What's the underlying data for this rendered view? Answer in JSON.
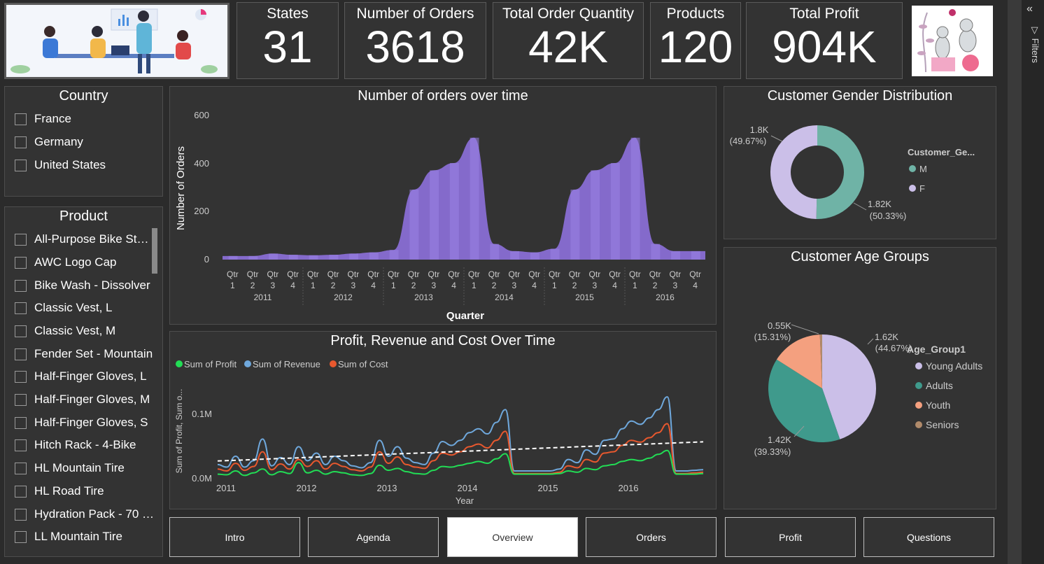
{
  "kpis": {
    "states": {
      "label": "States",
      "value": "31"
    },
    "orders": {
      "label": "Number of Orders",
      "value": "3618"
    },
    "quantity": {
      "label": "Total Order Quantity",
      "value": "42K"
    },
    "products": {
      "label": "Products",
      "value": "120"
    },
    "profit": {
      "label": "Total Profit",
      "value": "904K"
    }
  },
  "country_slicer": {
    "title": "Country",
    "items": [
      "France",
      "Germany",
      "United States"
    ]
  },
  "product_slicer": {
    "title": "Product",
    "items": [
      "All-Purpose Bike St…",
      "AWC Logo Cap",
      "Bike Wash - Dissolver",
      "Classic Vest, L",
      "Classic Vest, M",
      "Fender Set - Mountain",
      "Half-Finger Gloves, L",
      "Half-Finger Gloves, M",
      "Half-Finger Gloves, S",
      "Hitch Rack - 4-Bike",
      "HL Mountain Tire",
      "HL Road Tire",
      "Hydration Pack - 70 …",
      "LL Mountain Tire"
    ]
  },
  "orders_chart": {
    "title": "Number of orders over time",
    "ylabel": "Number of Orders",
    "xlabel": "Quarter",
    "yticks": [
      "600",
      "400",
      "200",
      "0"
    ],
    "quarters": [
      "Qtr 1",
      "Qtr 2",
      "Qtr 3",
      "Qtr 4"
    ],
    "years": [
      "2011",
      "2012",
      "2013",
      "2014",
      "2015",
      "2016"
    ]
  },
  "profit_chart": {
    "title": "Profit, Revenue and Cost Over Time",
    "legend": [
      "Sum of Profit",
      "Sum of Revenue",
      "Sum of Cost"
    ],
    "ylabel": "Sum of Profit, Sum o...",
    "xlabel": "Year",
    "yticks": [
      "0.1M",
      "0.0M"
    ],
    "xticks": [
      "2011",
      "2012",
      "2013",
      "2014",
      "2015",
      "2016"
    ]
  },
  "gender_chart": {
    "title": "Customer Gender Distribution",
    "legend_title": "Customer_Ge...",
    "labels": {
      "f_value": "1.8K",
      "f_pct": "(49.67%)",
      "m_value": "1.82K",
      "m_pct": "(50.33%)"
    },
    "legend": [
      "M",
      "F"
    ]
  },
  "age_chart": {
    "title": "Customer Age Groups",
    "legend_title": "Age_Group1",
    "legend": [
      "Young Adults",
      "Adults",
      "Youth",
      "Seniors"
    ],
    "labels": {
      "ya_value": "1.62K",
      "ya_pct": "(44.67%)",
      "ad_value": "1.42K",
      "ad_pct": "(39.33%)",
      "yo_value": "0.55K",
      "yo_pct": "(15.31%)"
    }
  },
  "nav": [
    "Intro",
    "Agenda",
    "Overview",
    "Orders",
    "Profit",
    "Questions"
  ],
  "filters_label": "Filters",
  "colors": {
    "purple": "#8b6fd8",
    "teal": "#6fb3a6",
    "lavender": "#cbbfe8",
    "profit": "#22dd55",
    "revenue": "#6fa8dc",
    "cost": "#e8582e",
    "adults": "#3f9a8c",
    "youth": "#f4a07f",
    "seniors": "#b08a6a"
  },
  "chart_data": [
    {
      "type": "area",
      "title": "Number of orders over time",
      "xlabel": "Quarter",
      "ylabel": "Number of Orders",
      "ylim": [
        0,
        600
      ],
      "x": [
        "2011 Q1",
        "2011 Q2",
        "2011 Q3",
        "2011 Q4",
        "2012 Q1",
        "2012 Q2",
        "2012 Q3",
        "2012 Q4",
        "2013 Q1",
        "2013 Q2",
        "2013 Q3",
        "2013 Q4",
        "2014 Q1",
        "2014 Q2",
        "2014 Q3",
        "2014 Q4",
        "2015 Q1",
        "2015 Q2",
        "2015 Q3",
        "2015 Q4",
        "2016 Q1",
        "2016 Q2",
        "2016 Q3",
        "2016 Q4"
      ],
      "values": [
        15,
        15,
        25,
        20,
        18,
        20,
        25,
        30,
        40,
        290,
        370,
        400,
        505,
        65,
        35,
        30,
        45,
        290,
        370,
        400,
        505,
        65,
        35,
        35
      ]
    },
    {
      "type": "line",
      "title": "Profit, Revenue and Cost Over Time",
      "xlabel": "Year",
      "ylim": [
        0,
        0.13
      ],
      "x_start": "2011",
      "x_end": "2016",
      "series": [
        {
          "name": "Sum of Profit",
          "values": [
            0.007,
            0.006,
            0.012,
            0.005,
            0.009,
            0.015,
            0.006,
            0.011,
            0.008,
            0.025,
            0.009,
            0.013,
            0.007,
            0.011,
            0.009,
            0.006,
            0.005,
            0.008,
            0.021,
            0.013,
            0.016,
            0.011,
            0.008,
            0.007,
            0.013,
            0.019,
            0.018,
            0.021,
            0.024,
            0.027,
            0.024,
            0.031,
            0.039,
            0.007,
            0.007,
            0.007,
            0.007,
            0.007,
            0.008,
            0.012,
            0.01,
            0.016,
            0.014,
            0.02,
            0.022,
            0.027,
            0.03,
            0.028,
            0.032,
            0.038,
            0.044,
            0.007,
            0.007,
            0.007,
            0.008
          ]
        },
        {
          "name": "Sum of Revenue",
          "values": [
            0.022,
            0.018,
            0.035,
            0.018,
            0.028,
            0.062,
            0.02,
            0.033,
            0.022,
            0.05,
            0.028,
            0.04,
            0.022,
            0.035,
            0.028,
            0.02,
            0.017,
            0.025,
            0.06,
            0.035,
            0.05,
            0.032,
            0.025,
            0.022,
            0.04,
            0.058,
            0.052,
            0.06,
            0.072,
            0.078,
            0.07,
            0.088,
            0.108,
            0.012,
            0.012,
            0.012,
            0.012,
            0.012,
            0.015,
            0.03,
            0.025,
            0.045,
            0.038,
            0.06,
            0.062,
            0.078,
            0.09,
            0.085,
            0.095,
            0.108,
            0.128,
            0.012,
            0.012,
            0.013,
            0.014
          ]
        },
        {
          "name": "Sum of Cost",
          "values": [
            0.015,
            0.012,
            0.024,
            0.013,
            0.019,
            0.042,
            0.014,
            0.023,
            0.015,
            0.03,
            0.019,
            0.028,
            0.015,
            0.024,
            0.019,
            0.014,
            0.012,
            0.018,
            0.042,
            0.024,
            0.034,
            0.022,
            0.018,
            0.016,
            0.028,
            0.04,
            0.037,
            0.042,
            0.05,
            0.054,
            0.048,
            0.06,
            0.074,
            0.008,
            0.008,
            0.008,
            0.008,
            0.008,
            0.01,
            0.02,
            0.017,
            0.03,
            0.026,
            0.04,
            0.042,
            0.052,
            0.06,
            0.057,
            0.064,
            0.072,
            0.086,
            0.008,
            0.008,
            0.009,
            0.01
          ]
        }
      ]
    },
    {
      "type": "pie",
      "title": "Customer Gender Distribution",
      "categories": [
        "M",
        "F"
      ],
      "values": [
        50.33,
        49.67
      ]
    },
    {
      "type": "pie",
      "title": "Customer Age Groups",
      "categories": [
        "Young Adults",
        "Adults",
        "Youth",
        "Seniors"
      ],
      "values": [
        44.67,
        39.33,
        15.31,
        0.69
      ]
    }
  ]
}
